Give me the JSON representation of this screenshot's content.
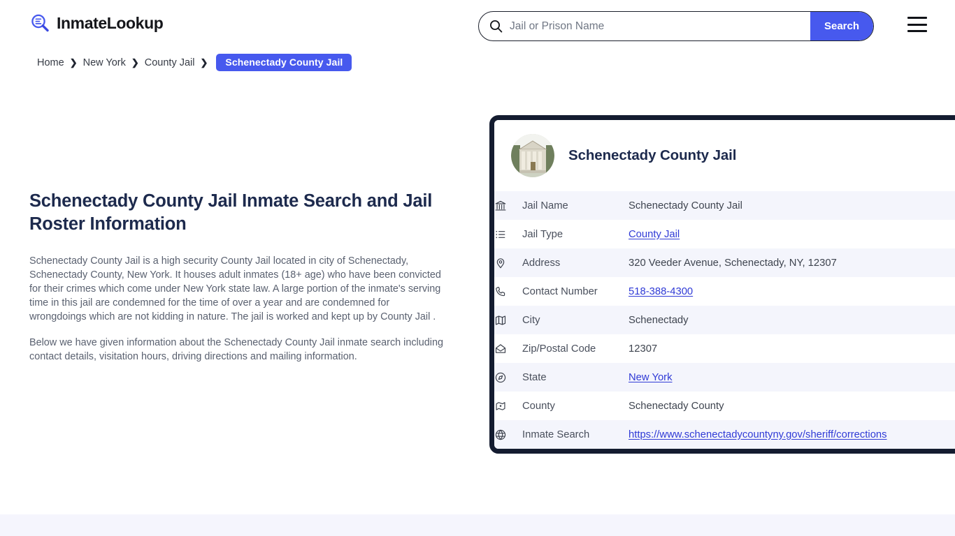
{
  "header": {
    "brand_name": "InmateLookup",
    "brand_icon": "magnifier-list-icon",
    "search": {
      "placeholder": "Jail or Prison Name",
      "value": "",
      "icon": "search-icon",
      "button_label": "Search"
    },
    "menu_icon": "hamburger-menu-icon"
  },
  "breadcrumb": {
    "items": [
      {
        "label": "Home"
      },
      {
        "label": "New York"
      },
      {
        "label": "County Jail"
      }
    ],
    "separator": "❯",
    "current": "Schenectady County Jail"
  },
  "main": {
    "heading": "Schenectady County Jail Inmate Search and Jail Roster Information",
    "paragraphs": [
      "Schenectady County Jail is a high security County Jail located in city of Schenectady, Schenectady County, New York. It houses adult inmates (18+ age) who have been convicted for their crimes which come under New York state law. A large portion of the inmate's serving time in this jail are condemned for the time of over a year and are condemned for wrongdoings which are not kidding in nature. The jail is worked and kept up by County Jail .",
      "Below we have given information about the Schenectady County Jail inmate search including contact details, visitation hours, driving directions and mailing information."
    ]
  },
  "card": {
    "title": "Schenectady County Jail",
    "avatar_icon": "courthouse-building-photo",
    "rows": [
      {
        "icon": "bank-building-icon",
        "label": "Jail Name",
        "value": "Schenectady County Jail",
        "link": false
      },
      {
        "icon": "list-icon",
        "label": "Jail Type",
        "value": "County Jail",
        "link": true
      },
      {
        "icon": "map-pin-icon",
        "label": "Address",
        "value": "320 Veeder Avenue, Schenectady, NY, 12307",
        "link": false
      },
      {
        "icon": "phone-icon",
        "label": "Contact Number",
        "value": "518-388-4300",
        "link": true
      },
      {
        "icon": "map-icon",
        "label": "City",
        "value": "Schenectady",
        "link": false
      },
      {
        "icon": "envelope-icon",
        "label": "Zip/Postal Code",
        "value": "12307",
        "link": false
      },
      {
        "icon": "compass-icon",
        "label": "State",
        "value": "New York",
        "link": true
      },
      {
        "icon": "map-marker-area-icon",
        "label": "County",
        "value": "Schenectady County",
        "link": false
      },
      {
        "icon": "globe-icon",
        "label": "Inmate Search",
        "value": "https://www.schenectadycountyny.gov/sheriff/corrections",
        "link": true
      }
    ]
  },
  "colors": {
    "accent_blue": "#4759ee",
    "link_blue": "#2f3ad6",
    "card_border_navy": "#141c30",
    "heading_navy": "#1d2a4d",
    "row_alt_bg": "#f4f5fc",
    "footer_band_bg": "#f5f5fd"
  }
}
